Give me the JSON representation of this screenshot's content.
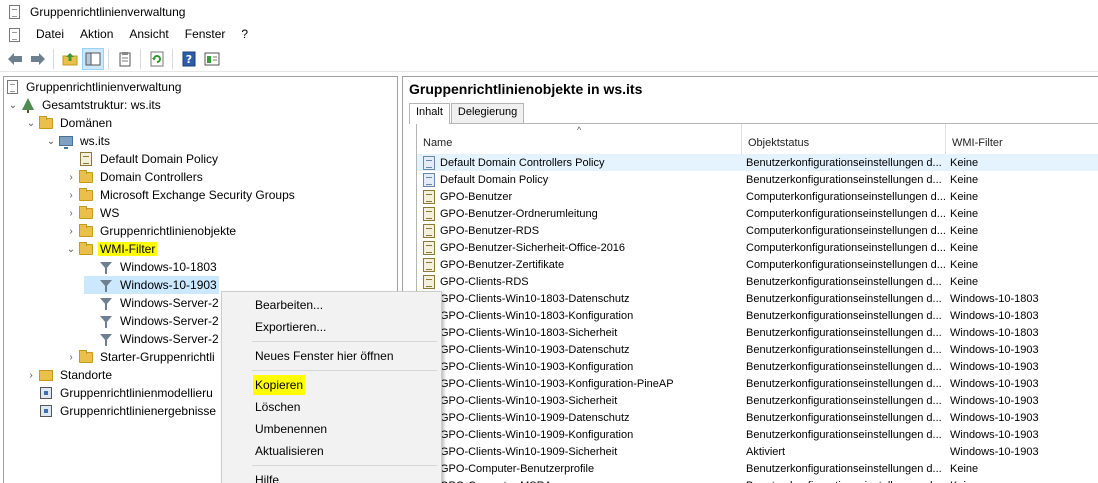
{
  "window": {
    "title": "Gruppenrichtlinienverwaltung"
  },
  "menubar": {
    "items": [
      "Datei",
      "Aktion",
      "Ansicht",
      "Fenster",
      "?"
    ]
  },
  "toolbar": {
    "icons": [
      "back-arrow-icon",
      "forward-arrow-icon",
      "up-folder-icon",
      "show-tree-icon",
      "properties-icon",
      "refresh-icon",
      "help-icon",
      "console-view-icon"
    ]
  },
  "tree": {
    "root": "Gruppenrichtlinienverwaltung",
    "forest": "Gesamtstruktur: ws.its",
    "domains": "Domänen",
    "domain": "ws.its",
    "default_domain_policy": "Default Domain Policy",
    "domain_controllers": "Domain Controllers",
    "exchange_groups": "Microsoft Exchange Security Groups",
    "ws": "WS",
    "gpo_objects": "Gruppenrichtlinienobjekte",
    "wmi_filter": "WMI-Filter",
    "wmi_items": [
      "Windows-10-1803",
      "Windows-10-1903",
      "Windows-Server-2",
      "Windows-Server-2",
      "Windows-Server-2"
    ],
    "starter": "Starter-Gruppenrichtli",
    "sites": "Standorte",
    "modeling": "Gruppenrichtlinienmodellieru",
    "results": "Gruppenrichtlinienergebnisse"
  },
  "context_menu": {
    "items": [
      "Bearbeiten...",
      "Exportieren...",
      "Neues Fenster hier öffnen",
      "Kopieren",
      "Löschen",
      "Umbenennen",
      "Aktualisieren",
      "Hilfe"
    ]
  },
  "right": {
    "title": "Gruppenrichtlinienobjekte in ws.its",
    "tabs": [
      "Inhalt",
      "Delegierung"
    ],
    "columns": [
      "Name",
      "Objektstatus",
      "WMI-Filter"
    ],
    "rows": [
      {
        "name": "Default Domain Controllers Policy",
        "status": "Benutzerkonfigurationseinstellungen d...",
        "wmi": "Keine"
      },
      {
        "name": "Default Domain Policy",
        "status": "Benutzerkonfigurationseinstellungen d...",
        "wmi": "Keine"
      },
      {
        "name": "GPO-Benutzer",
        "status": "Computerkonfigurationseinstellungen d...",
        "wmi": "Keine"
      },
      {
        "name": "GPO-Benutzer-Ordnerumleitung",
        "status": "Computerkonfigurationseinstellungen d...",
        "wmi": "Keine"
      },
      {
        "name": "GPO-Benutzer-RDS",
        "status": "Computerkonfigurationseinstellungen d...",
        "wmi": "Keine"
      },
      {
        "name": "GPO-Benutzer-Sicherheit-Office-2016",
        "status": "Computerkonfigurationseinstellungen d...",
        "wmi": "Keine"
      },
      {
        "name": "GPO-Benutzer-Zertifikate",
        "status": "Computerkonfigurationseinstellungen d...",
        "wmi": "Keine"
      },
      {
        "name": "GPO-Clients-RDS",
        "status": "Benutzerkonfigurationseinstellungen d...",
        "wmi": "Keine"
      },
      {
        "name": "GPO-Clients-Win10-1803-Datenschutz",
        "status": "Benutzerkonfigurationseinstellungen d...",
        "wmi": "Windows-10-1803"
      },
      {
        "name": "GPO-Clients-Win10-1803-Konfiguration",
        "status": "Benutzerkonfigurationseinstellungen d...",
        "wmi": "Windows-10-1803"
      },
      {
        "name": "GPO-Clients-Win10-1803-Sicherheit",
        "status": "Benutzerkonfigurationseinstellungen d...",
        "wmi": "Windows-10-1803"
      },
      {
        "name": "GPO-Clients-Win10-1903-Datenschutz",
        "status": "Benutzerkonfigurationseinstellungen d...",
        "wmi": "Windows-10-1903"
      },
      {
        "name": "GPO-Clients-Win10-1903-Konfiguration",
        "status": "Benutzerkonfigurationseinstellungen d...",
        "wmi": "Windows-10-1903"
      },
      {
        "name": "GPO-Clients-Win10-1903-Konfiguration-PineAP",
        "status": "Benutzerkonfigurationseinstellungen d...",
        "wmi": "Windows-10-1903"
      },
      {
        "name": "GPO-Clients-Win10-1903-Sicherheit",
        "status": "Benutzerkonfigurationseinstellungen d...",
        "wmi": "Windows-10-1903"
      },
      {
        "name": "GPO-Clients-Win10-1909-Datenschutz",
        "status": "Benutzerkonfigurationseinstellungen d...",
        "wmi": "Windows-10-1903"
      },
      {
        "name": "GPO-Clients-Win10-1909-Konfiguration",
        "status": "Benutzerkonfigurationseinstellungen d...",
        "wmi": "Windows-10-1903"
      },
      {
        "name": "GPO-Clients-Win10-1909-Sicherheit",
        "status": "Aktiviert",
        "wmi": "Windows-10-1903"
      },
      {
        "name": "GPO-Computer-Benutzerprofile",
        "status": "Benutzerkonfigurationseinstellungen d...",
        "wmi": "Keine"
      },
      {
        "name": "GPO-Computer-MSRA",
        "status": "Benutzerkonfigurationseinstellungen d...",
        "wmi": "Keine"
      }
    ]
  },
  "colors": {
    "selection": "#cce8ff",
    "highlight": "#ffff00",
    "menu_bg": "#f2f2f2"
  }
}
